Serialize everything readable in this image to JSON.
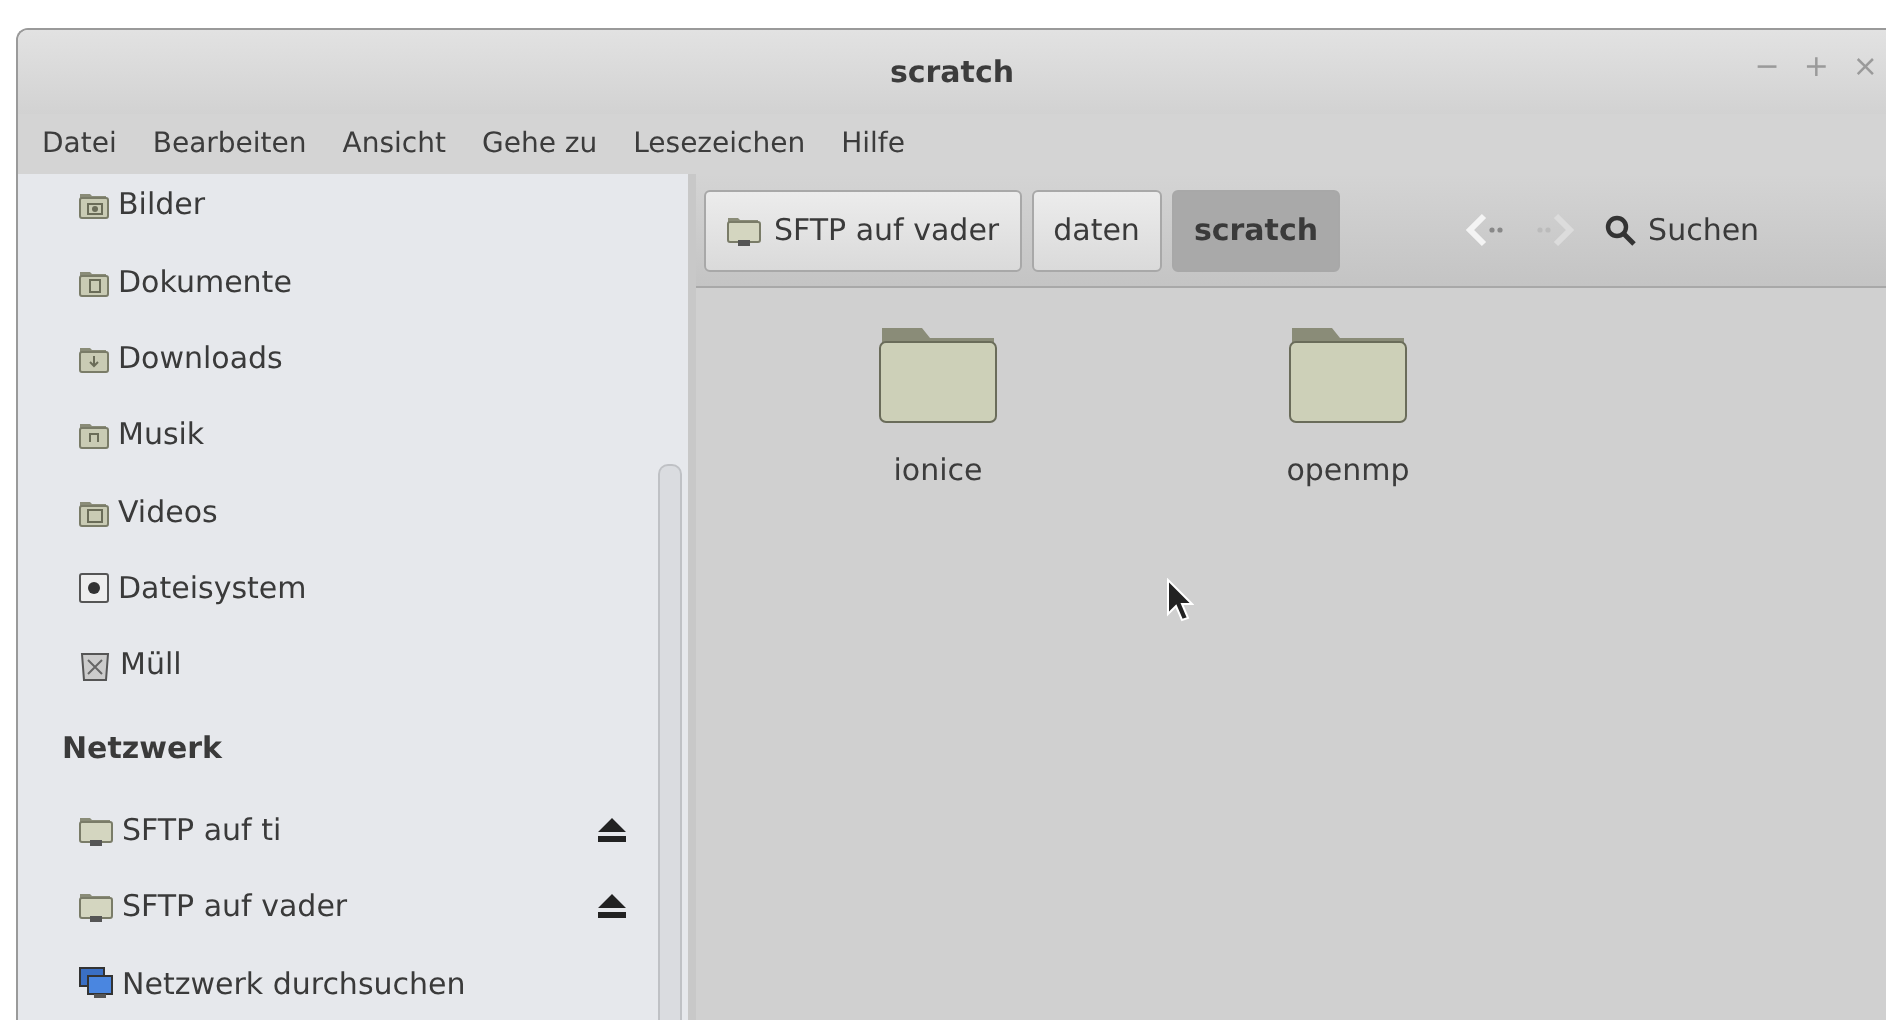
{
  "window": {
    "title": "scratch",
    "controls": [
      "−",
      "+",
      "×"
    ]
  },
  "menu": [
    "Datei",
    "Bearbeiten",
    "Ansicht",
    "Gehe zu",
    "Lesezeichen",
    "Hilfe"
  ],
  "sidebar": {
    "places": [
      {
        "label": "Bilder",
        "kind": "pictures"
      },
      {
        "label": "Dokumente",
        "kind": "documents"
      },
      {
        "label": "Downloads",
        "kind": "downloads"
      },
      {
        "label": "Musik",
        "kind": "music"
      },
      {
        "label": "Videos",
        "kind": "videos"
      },
      {
        "label": "Dateisystem",
        "kind": "filesystem"
      },
      {
        "label": "Müll",
        "kind": "trash"
      }
    ],
    "network_heading": "Netzwerk",
    "network": [
      {
        "label": "SFTP auf ti",
        "kind": "remote",
        "mounted": true
      },
      {
        "label": "SFTP auf vader",
        "kind": "remote",
        "mounted": true
      },
      {
        "label": "Netzwerk durchsuchen",
        "kind": "network",
        "mounted": false
      }
    ]
  },
  "breadcrumbs": [
    {
      "label": "SFTP auf vader",
      "kind": "remote",
      "selected": false
    },
    {
      "label": "daten",
      "selected": false
    },
    {
      "label": "scratch",
      "selected": true
    }
  ],
  "nav": {
    "back": {
      "disabled": false
    },
    "forward": {
      "disabled": true
    }
  },
  "search": {
    "label": "Suchen"
  },
  "files": [
    {
      "name": "ionice"
    },
    {
      "name": "openmp"
    }
  ]
}
